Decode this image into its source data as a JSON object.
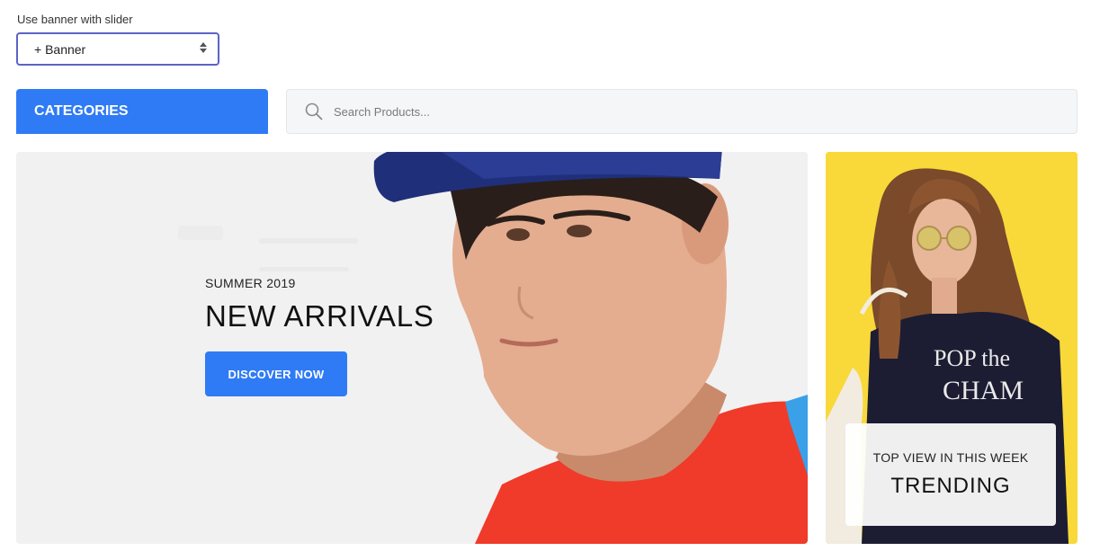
{
  "form": {
    "label": "Use banner with slider",
    "select_value": "+ Banner"
  },
  "nav": {
    "categories_label": "CATEGORIES"
  },
  "search": {
    "placeholder": "Search Products..."
  },
  "hero": {
    "eyebrow": "SUMMER 2019",
    "title": "NEW ARRIVALS",
    "cta_label": "DISCOVER NOW"
  },
  "side_banner": {
    "subtitle": "TOP VIEW IN THIS WEEK",
    "title": "TRENDING",
    "shirt_text": "POP the CHAM PAGNE"
  },
  "colors": {
    "accent": "#2f7bf5",
    "select_border": "#5c63c8",
    "side_bg": "#f9d83a",
    "shirt_red": "#f03a2a"
  }
}
